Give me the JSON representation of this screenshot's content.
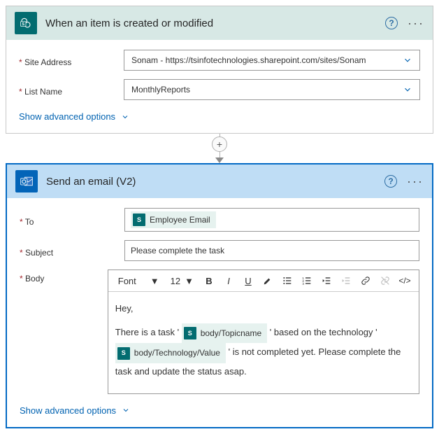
{
  "trigger": {
    "title": "When an item is created or modified",
    "labels": {
      "site": "Site Address",
      "list": "List Name"
    },
    "site_value": "Sonam - https://tsinfotechnologies.sharepoint.com/sites/Sonam",
    "list_value": "MonthlyReports",
    "advanced": "Show advanced options"
  },
  "action": {
    "title": "Send an email (V2)",
    "labels": {
      "to": "To",
      "subject": "Subject",
      "body": "Body"
    },
    "to_token": "Employee Email",
    "subject_value": "Please complete the task",
    "rte": {
      "font_label": "Font",
      "size_label": "12"
    },
    "body_text": {
      "greeting": "Hey,",
      "p_a": "There is a task '",
      "token1": "body/Topicname",
      "p_b": "' based on the technology '",
      "token2": "body/Technology/Value",
      "p_c": "' is not completed yet. Please complete the task and update the status asap."
    },
    "advanced": "Show advanced options"
  },
  "required_mark": "*"
}
